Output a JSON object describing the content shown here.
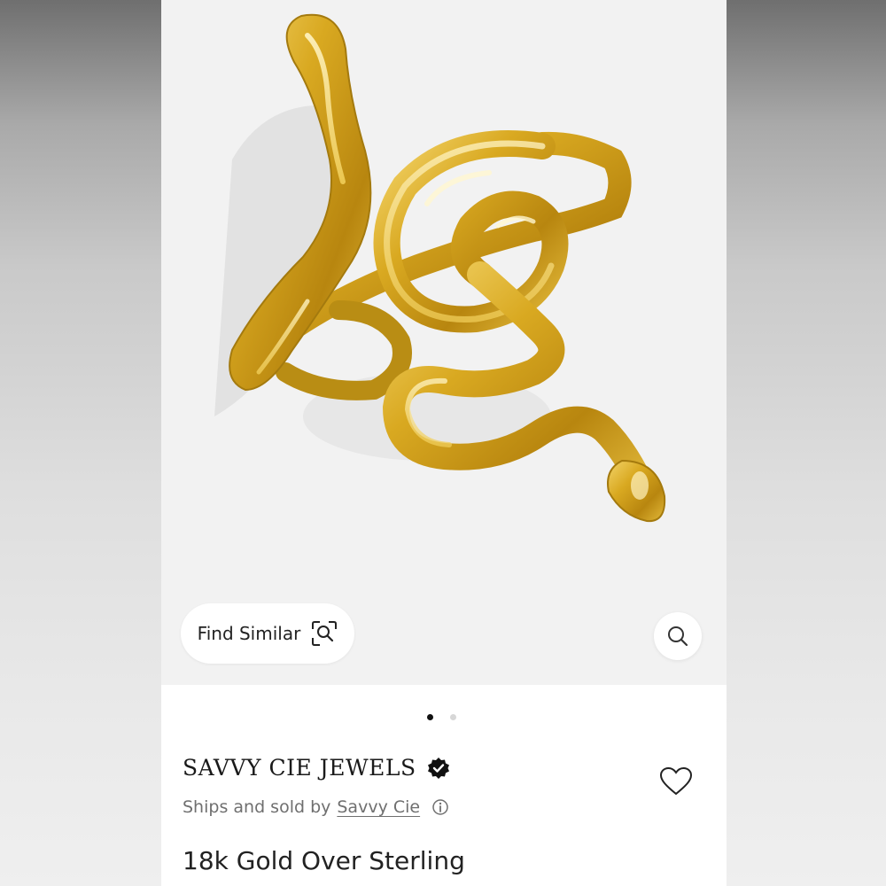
{
  "gallery": {
    "find_similar_label": "Find Similar",
    "current_slide": 1,
    "total_slides": 2,
    "product_image_alt": "Gold snake ring"
  },
  "seller": {
    "brand": "SAVVY CIE JEWELS",
    "verified": true,
    "ships_prefix": "Ships and sold by",
    "seller_link": "Savvy Cie"
  },
  "product": {
    "title": "18k Gold Over Sterling"
  },
  "icons": {
    "find_similar": "image-search-icon",
    "zoom": "magnifier-icon",
    "verified": "verified-badge-icon",
    "info": "info-icon",
    "favorite": "heart-icon"
  },
  "colors": {
    "gold": "#d4a419",
    "gallery_bg": "#f2f2f2",
    "text": "#222222",
    "muted": "#6f6f6f"
  }
}
